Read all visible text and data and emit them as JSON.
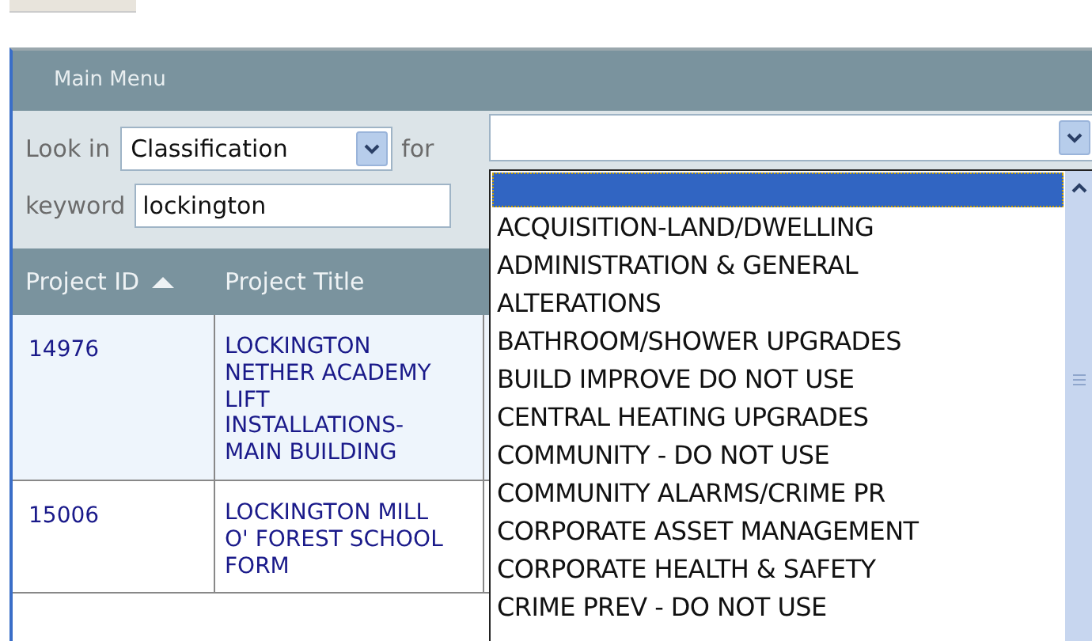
{
  "panel": {
    "title": "Main Menu"
  },
  "search": {
    "look_in_label": "Look in",
    "look_in_value": "Classification",
    "for_label": "for",
    "keyword_label": "keyword",
    "keyword_value": "lockington"
  },
  "table": {
    "columns": [
      {
        "label": "Project ID",
        "sorted": true
      },
      {
        "label": "Project Title"
      }
    ],
    "rows": [
      {
        "id": "14976",
        "title": "LOCKINGTON NETHER ACADEMY LIFT INSTALLATIONS-MAIN BUILDING",
        "selected": true
      },
      {
        "id": "15006",
        "title": "LOCKINGTON MILL O' FOREST SCHOOL FORM",
        "selected": false
      }
    ]
  },
  "dropdown": {
    "options": [
      {
        "selected": true
      },
      {
        "label": "ACQUISITION-LAND/DWELLING",
        "selected": false
      },
      {
        "label": "ADMINISTRATION & GENERAL",
        "selected": false
      },
      {
        "label": "ALTERATIONS",
        "selected": false
      },
      {
        "label": "BATHROOM/SHOWER UPGRADES",
        "selected": false
      },
      {
        "label": "BUILD IMPROVE DO NOT USE",
        "selected": false
      },
      {
        "label": "CENTRAL HEATING UPGRADES",
        "selected": false
      },
      {
        "label": "COMMUNITY - DO NOT USE",
        "selected": false
      },
      {
        "label": "COMMUNITY ALARMS/CRIME PR",
        "selected": false
      },
      {
        "label": "CORPORATE ASSET MANAGEMENT",
        "selected": false
      },
      {
        "label": "CORPORATE HEALTH & SAFETY",
        "selected": false
      },
      {
        "label": "CRIME PREV - DO NOT USE",
        "selected": false
      }
    ]
  }
}
